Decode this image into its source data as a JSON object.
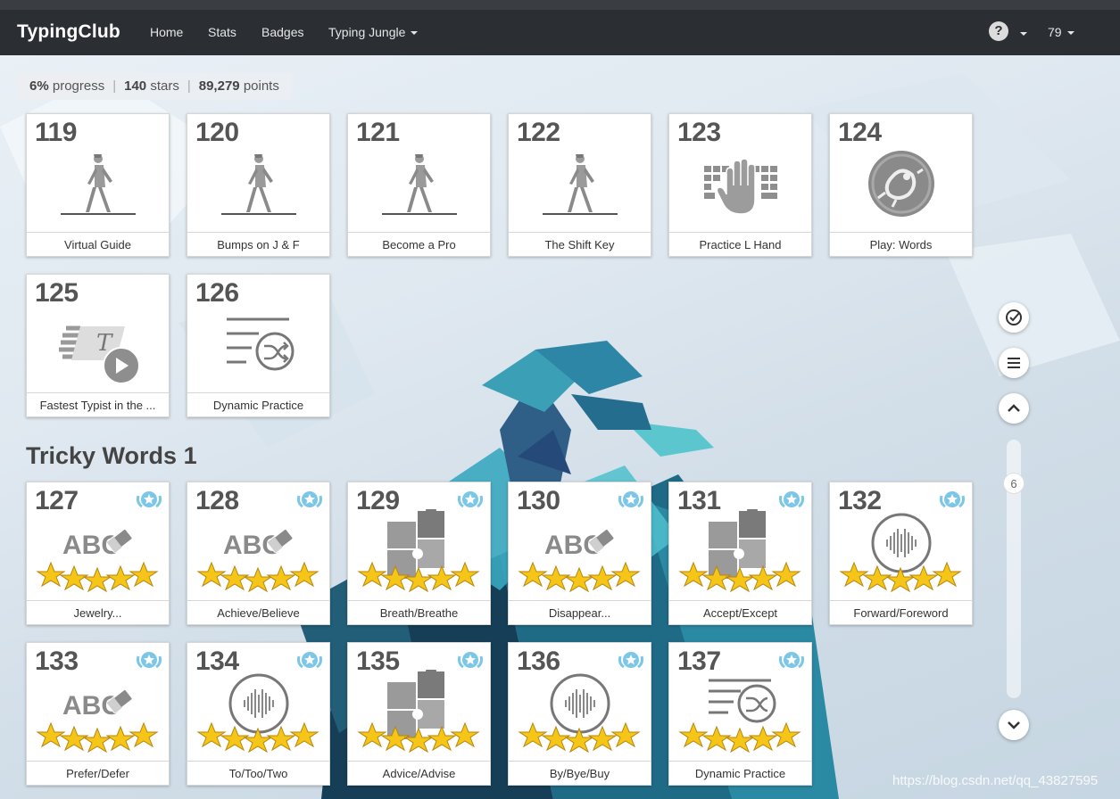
{
  "nav": {
    "brand": "TypingClub",
    "items": [
      "Home",
      "Stats",
      "Badges",
      "Typing Jungle"
    ],
    "help_label": "?",
    "user_label": "79"
  },
  "progress": {
    "percent": "6%",
    "percent_label": "progress",
    "stars": "140",
    "stars_label": "stars",
    "points": "89,279",
    "points_label": "points"
  },
  "lessons_top": [
    {
      "num": "119",
      "label": "Virtual Guide",
      "icon": "walking-person-icon"
    },
    {
      "num": "120",
      "label": "Bumps on J & F",
      "icon": "walking-person-icon"
    },
    {
      "num": "121",
      "label": "Become a Pro",
      "icon": "walking-person-icon"
    },
    {
      "num": "122",
      "label": "The Shift Key",
      "icon": "walking-person-icon"
    },
    {
      "num": "123",
      "label": "Practice L Hand",
      "icon": "keyboard-hand-icon"
    },
    {
      "num": "124",
      "label": "Play: Words",
      "icon": "game-bug-icon"
    },
    {
      "num": "125",
      "label": "Fastest Typist in the ...",
      "icon": "fast-typist-video-icon"
    },
    {
      "num": "126",
      "label": "Dynamic Practice",
      "icon": "shuffle-lines-icon"
    }
  ],
  "section": {
    "title": "Tricky Words 1"
  },
  "lessons_tricky": [
    {
      "num": "127",
      "label": "Jewelry...",
      "icon": "abc-eraser-icon",
      "stars": 5
    },
    {
      "num": "128",
      "label": "Achieve/Believe",
      "icon": "abc-eraser-icon",
      "stars": 5
    },
    {
      "num": "129",
      "label": "Breath/Breathe",
      "icon": "puzzle-icon",
      "stars": 5
    },
    {
      "num": "130",
      "label": "Disappear...",
      "icon": "abc-eraser-icon",
      "stars": 5
    },
    {
      "num": "131",
      "label": "Accept/Except",
      "icon": "puzzle-icon",
      "stars": 5
    },
    {
      "num": "132",
      "label": "Forward/Foreword",
      "icon": "audio-wave-icon",
      "stars": 5
    },
    {
      "num": "133",
      "label": "Prefer/Defer",
      "icon": "abc-eraser-icon",
      "stars": 5
    },
    {
      "num": "134",
      "label": "To/Too/Two",
      "icon": "audio-wave-icon",
      "stars": 5
    },
    {
      "num": "135",
      "label": "Advice/Advise",
      "icon": "puzzle-icon",
      "stars": 5
    },
    {
      "num": "136",
      "label": "By/Bye/Buy",
      "icon": "audio-wave-icon",
      "stars": 5
    },
    {
      "num": "137",
      "label": "Dynamic Practice",
      "icon": "shuffle-lines-icon",
      "stars": 5
    }
  ],
  "sidebar": {
    "scroll_label": "6"
  },
  "watermark": "https://blog.csdn.net/qq_43827595"
}
